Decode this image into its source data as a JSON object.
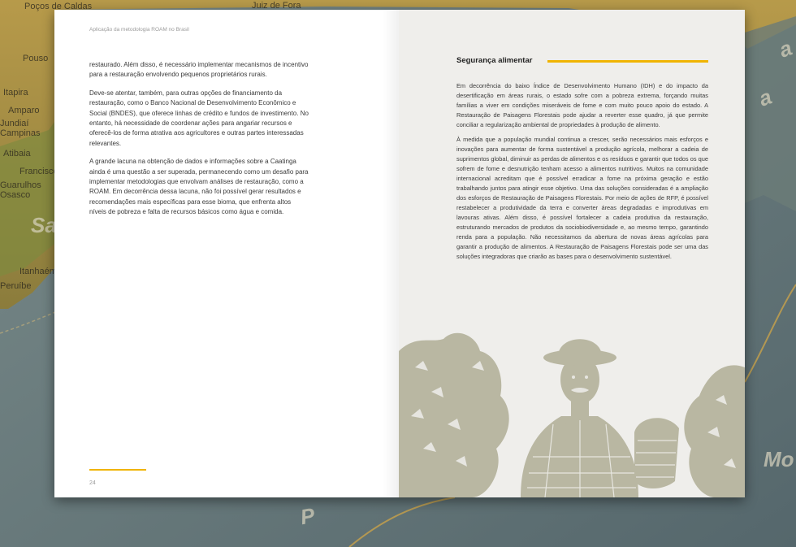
{
  "background_map": {
    "labels": [
      "Poços de Caldas",
      "Juiz de Fora",
      "Pouso",
      "Itapira",
      "Amparo",
      "Jundiaí",
      "Campinas",
      "Atibaia",
      "Francisco",
      "Guarulhos",
      "Osasco",
      "Itanhaém",
      "Peruíbe",
      "Sa",
      "Mo",
      "P",
      "a",
      "a"
    ]
  },
  "left_page": {
    "running_head": "Aplicação da metodologia ROAM no Brasil",
    "paragraphs": [
      "restaurado. Além disso, é necessário implementar mecanismos de incentivo para a restauração envolvendo pequenos proprietários rurais.",
      "Deve-se atentar, também, para outras opções de financiamento da restauração, como o Banco Nacional de Desenvolvimento Econômico e Social (BNDES), que oferece linhas de crédito e fundos de investimento. No entanto, há necessidade de coordenar ações para angariar recursos e oferecê-los de forma atrativa aos agricultores e outras partes interessadas relevantes.",
      "A grande lacuna na obtenção de dados e informações sobre a Caatinga ainda é uma questão a ser superada, permanecendo como um desafio para implementar metodologias que envolvam análises de restauração, como a ROAM. Em decorrência dessa lacuna, não foi possível gerar resultados e recomendações mais específicas para esse bioma, que enfrenta altos níveis de pobreza e falta de recursos básicos como água e comida."
    ],
    "page_number": "24"
  },
  "right_page": {
    "section_title": "Segurança alimentar",
    "paragraphs": [
      "Em decorrência do baixo Índice de Desenvolvimento Humano (IDH) e do impacto da desertificação em áreas rurais, o estado sofre com a pobreza extrema, forçando muitas famílias a viver em condições miseráveis de fome e com muito pouco apoio do estado. A Restauração de Paisagens Florestais pode ajudar a reverter esse quadro, já que permite conciliar a regularização ambiental de propriedades à produção de alimento.",
      "À medida que a população mundial continua a crescer, serão necessários mais esforços e inovações para aumentar de forma sustentável a produção agrícola, melhorar a cadeia de suprimentos global, diminuir as perdas de alimentos e os resíduos e garantir que todos os que sofrem de fome e desnutrição tenham acesso a alimentos nutritivos. Muitos na comunidade internacional acreditam que é possível erradicar a fome na próxima geração e estão trabalhando juntos para atingir esse objetivo. Uma das soluções consideradas é a ampliação dos esforços de Restauração de Paisagens Florestais. Por meio de ações de RFP, é possível restabelecer a produtividade da terra e converter áreas degradadas e improdutivas em lavouras ativas. Além disso, é possível fortalecer a cadeia produtiva da restauração, estruturando mercados de produtos da sociobiodiversidade e, ao mesmo tempo, garantindo renda para a população. Não necessitamos da abertura de novas áreas agrícolas para garantir a produção de alimentos. A Restauração de Paisagens Florestais pode ser uma das soluções integradoras que criarão as bases para o desenvolvimento sustentável."
    ]
  },
  "colors": {
    "accent": "#f0b400",
    "illustration": "#b9b7a2",
    "right_page_bg": "#efeeeb"
  }
}
